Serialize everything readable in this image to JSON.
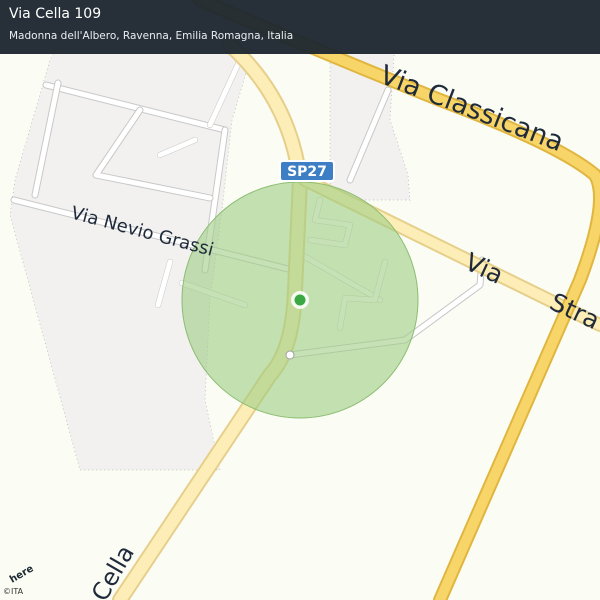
{
  "header": {
    "title": "Via Cella 109",
    "subtitle": "Madonna dell'Albero, Ravenna, Emilia Romagna, Italia"
  },
  "map": {
    "road_labels": {
      "via_classicana": "Via Classicana",
      "via_nevio_grassi": "Via Nevio Grassi",
      "via_stra_part1": "Via",
      "via_stra_part2": "Stra",
      "via_cella_partial": "Cella"
    },
    "route_shield": "SP27",
    "provider_logo": "here",
    "copyright": "©ITA",
    "colors": {
      "background": "#fbfdf4",
      "built_area": "#f2f1f0",
      "major_road": "#f8d568",
      "minor_road": "#fdeeb8",
      "accuracy_circle": "#9fcd84",
      "location_dot": "#3aa843",
      "shield": "#3e7ec4"
    },
    "icons": [
      "location-dot-icon",
      "route-shield-icon",
      "here-logo-icon"
    ]
  }
}
